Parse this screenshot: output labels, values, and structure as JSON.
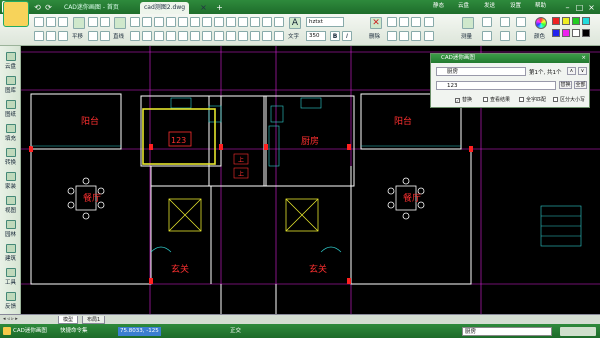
{
  "titlebar": {
    "tabs": [
      {
        "label": "CAD迷你画图 - 首页"
      },
      {
        "label": "cad测图2.dwg"
      }
    ],
    "right_items": [
      "静态",
      "云盘",
      "发送",
      "设置",
      "帮助"
    ]
  },
  "ribbon": {
    "labels": [
      "平移",
      "直线",
      "文字",
      "删除",
      "测量",
      "颜色"
    ],
    "font_name": "hztxt",
    "font_size": "350",
    "bold": "B",
    "italic": "I"
  },
  "leftbar": {
    "items": [
      "云盘",
      "图库",
      "图纸",
      "填充",
      "转换",
      "家装",
      "视图",
      "园林",
      "建筑",
      "工具",
      "反馈"
    ]
  },
  "drawing": {
    "labels": [
      "阳台",
      "123",
      "厨房",
      "阳台",
      "餐厅",
      "餐厅",
      "玄关",
      "玄关"
    ],
    "stair_labels": [
      "上",
      "上"
    ]
  },
  "findpanel": {
    "title": "CAD迷你画图",
    "search_value": "厨房",
    "match_info": "第1个, 共1个",
    "replace_value": "123",
    "replace_button": "替换",
    "replace_all_button": "全部",
    "options": [
      {
        "label": "替换",
        "checked": true
      },
      {
        "label": "查看结果",
        "checked": false
      },
      {
        "label": "全字匹配",
        "checked": false
      },
      {
        "label": "区分大小写",
        "checked": false
      }
    ]
  },
  "sheettabs": {
    "tabs": [
      "模型",
      "布局1"
    ]
  },
  "statusbar": {
    "app_name": "CAD迷你画图",
    "hint_label": "快捷命令集",
    "coords": "75.8033, -125",
    "mode": "正交",
    "command_value": "厨房"
  },
  "colors": {
    "accent_green": "#2e8a3c",
    "highlight_yellow": "#e6e62e",
    "wall_white": "#ffffff",
    "line_magenta": "#ff00ff",
    "label_red": "#ff3030"
  }
}
